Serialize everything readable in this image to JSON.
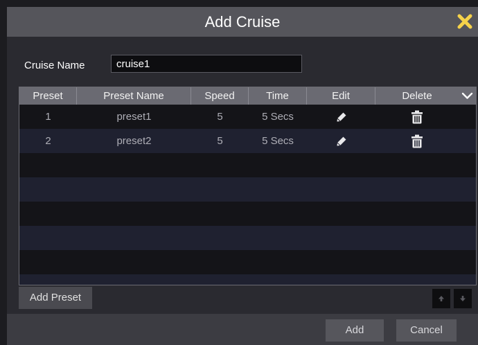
{
  "dialog": {
    "title": "Add Cruise"
  },
  "form": {
    "cruise_name_label": "Cruise Name",
    "cruise_name_value": "cruise1"
  },
  "table": {
    "columns": [
      "Preset",
      "Preset Name",
      "Speed",
      "Time",
      "Edit",
      "Delete"
    ],
    "rows": [
      {
        "preset": "1",
        "name": "preset1",
        "speed": "5",
        "time": "5 Secs"
      },
      {
        "preset": "2",
        "name": "preset2",
        "speed": "5",
        "time": "5 Secs"
      }
    ]
  },
  "buttons": {
    "add_preset": "Add Preset",
    "add": "Add",
    "cancel": "Cancel"
  },
  "icons": {
    "close": "close-icon",
    "edit": "pencil-icon",
    "delete": "trash-icon",
    "column_toggle": "chevron-down-icon",
    "move_up": "arrow-up-icon",
    "move_down": "arrow-down-icon"
  },
  "colors": {
    "close_icon": "#f5d24a",
    "title_bar": "#55555b",
    "header": "#6a6a72"
  }
}
